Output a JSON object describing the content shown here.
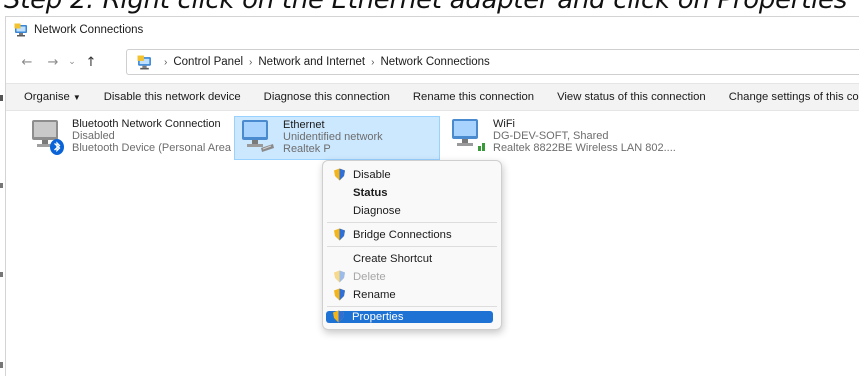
{
  "banner": {
    "text": "Step 2: Right click on the Ethernet adapter and click on Properties"
  },
  "window": {
    "title": "Network Connections"
  },
  "nav": {
    "back": "←",
    "forward": "→",
    "recent": "⌄",
    "up": "↑",
    "separator": "›",
    "breadcrumbs": [
      "Control Panel",
      "Network and Internet",
      "Network Connections"
    ]
  },
  "commands": {
    "organise": "Organise",
    "disable": "Disable this network device",
    "diagnose": "Diagnose this connection",
    "rename": "Rename this connection",
    "view_status": "View status of this connection",
    "change_settings": "Change settings of this connection"
  },
  "connections": [
    {
      "name": "Bluetooth Network Connection",
      "status": "Disabled",
      "device": "Bluetooth Device (Personal Area ..."
    },
    {
      "name": "Ethernet",
      "status": "Unidentified network",
      "device": "Realtek P"
    },
    {
      "name": "WiFi",
      "status": "DG-DEV-SOFT, Shared",
      "device": "Realtek 8822BE Wireless LAN 802...."
    }
  ],
  "context_menu": {
    "disable": "Disable",
    "status": "Status",
    "diagnose": "Diagnose",
    "bridge": "Bridge Connections",
    "shortcut": "Create Shortcut",
    "delete": "Delete",
    "rename": "Rename",
    "properties": "Properties"
  },
  "colors": {
    "accent": "#1e72d4",
    "selection_bg": "#cce8ff",
    "selection_border": "#99d1ff",
    "bluetooth": "#0a64d8"
  },
  "icons": {
    "title": "network-connections-icon",
    "address": "network-connections-icon",
    "bluetooth": "bluetooth-adapter-icon",
    "ethernet": "ethernet-adapter-icon",
    "wifi": "wifi-adapter-icon",
    "uac": "uac-shield-icon"
  }
}
